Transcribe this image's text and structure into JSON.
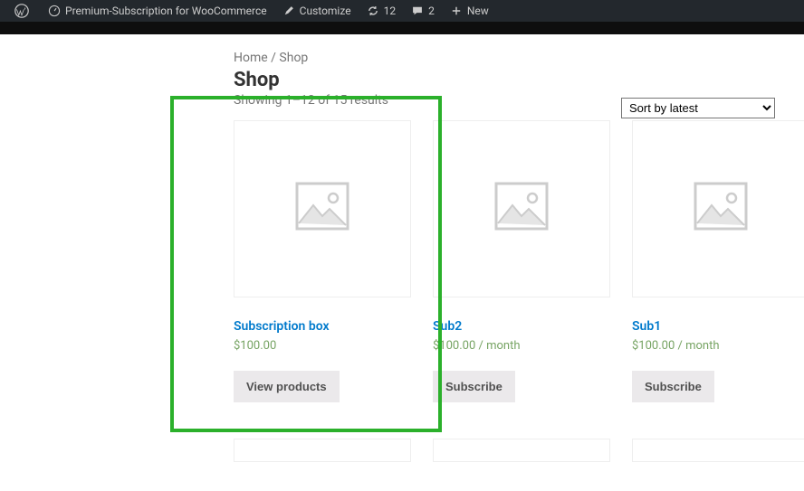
{
  "adminbar": {
    "site_title": "Premium-Subscription for WooCommerce",
    "customize": "Customize",
    "updates": "12",
    "comments": "2",
    "new": "New"
  },
  "breadcrumb": {
    "home": "Home",
    "sep": " / ",
    "current": "Shop"
  },
  "page_title": "Shop",
  "result_count": "Showing 1–12 of 15 results",
  "sort": {
    "selected": "Sort by latest"
  },
  "products": [
    {
      "title": "Subscription box",
      "price": "$100.00",
      "button": "View products"
    },
    {
      "title": "Sub2",
      "price": "$100.00 / month",
      "button": "Subscribe"
    },
    {
      "title": "Sub1",
      "price": "$100.00 / month",
      "button": "Subscribe"
    }
  ],
  "colors": {
    "link": "#007acc",
    "price": "#77a464",
    "highlight": "#2bb02b"
  }
}
